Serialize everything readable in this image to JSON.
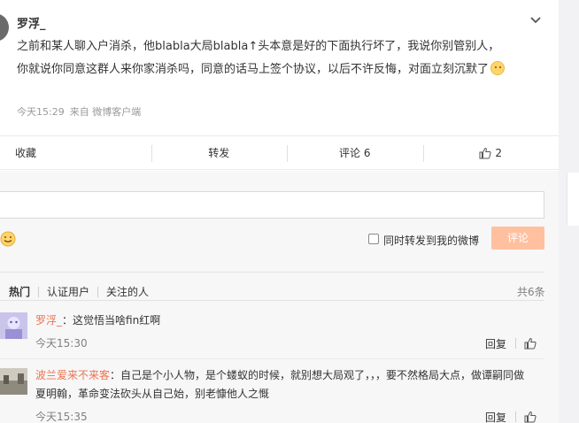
{
  "post": {
    "author": "罗浮_",
    "text_line1": "之前和某人聊入户消杀，他blabla大局blabla↑头本意是好的下面执行坏了，我说你别管别人，",
    "text_line2": "你就说你同意这群人来你家消杀吗，同意的话马上签个协议，以后不许反悔，对面立刻沉默了",
    "time": "今天15:29",
    "source": "来自 微博客户端"
  },
  "actions": {
    "favorite": "收藏",
    "repost": "转发",
    "comment": "评论 6",
    "like_count": "2"
  },
  "composer": {
    "repost_label": "同时转发到我的微博",
    "submit_label": "评论"
  },
  "comment_tabs": {
    "hot": "热门",
    "verified": "认证用户",
    "following": "关注的人",
    "total": "共6条"
  },
  "comments": [
    {
      "user": "罗浮_",
      "sep": "：",
      "text": "这觉悟当啥fin红啊",
      "time": "今天15:30",
      "reply": "回复"
    },
    {
      "user": "波兰爱来不来客",
      "sep": "：",
      "text_line1": "自己是个小人物，是个蝼蚁的时候，就别想大局观了，，，要不然格局大点，做谭嗣同做",
      "text_line2": "夏明翰，革命变法砍头从自己始，别老慷他人之慨",
      "time": "今天15:35",
      "reply": "回复"
    }
  ],
  "colors": {
    "accent": "#eb7350",
    "submit_disabled": "#ffc09f",
    "link": "#eb7350"
  }
}
